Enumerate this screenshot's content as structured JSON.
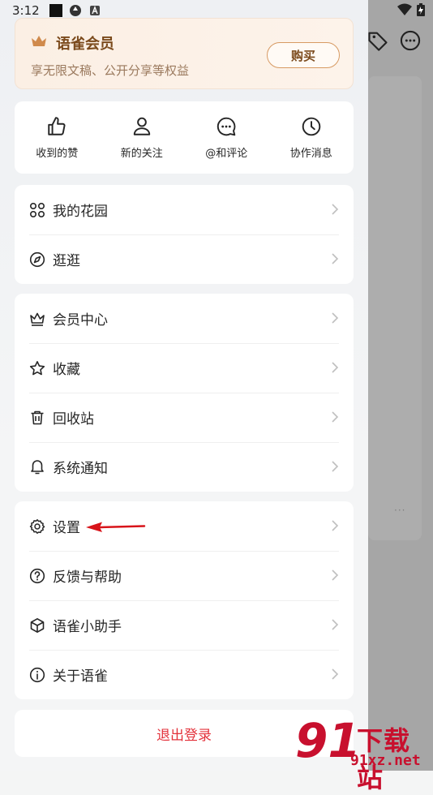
{
  "status_bar": {
    "time": "3:12"
  },
  "vip": {
    "title": "语雀会员",
    "subtitle": "享无限文稿、公开分享等权益",
    "buy_label": "购买"
  },
  "quick_actions": [
    {
      "label": "收到的赞",
      "icon": "thumbs-up-icon"
    },
    {
      "label": "新的关注",
      "icon": "person-icon"
    },
    {
      "label": "@和评论",
      "icon": "comment-icon"
    },
    {
      "label": "协作消息",
      "icon": "clock-icon"
    }
  ],
  "menu_group_1": [
    {
      "label": "我的花园",
      "icon": "garden-icon"
    },
    {
      "label": "逛逛",
      "icon": "compass-icon"
    }
  ],
  "menu_group_2": [
    {
      "label": "会员中心",
      "icon": "crown-icon"
    },
    {
      "label": "收藏",
      "icon": "star-icon"
    },
    {
      "label": "回收站",
      "icon": "trash-icon"
    },
    {
      "label": "系统通知",
      "icon": "bell-icon"
    }
  ],
  "menu_group_3": [
    {
      "label": "设置",
      "icon": "gear-icon"
    },
    {
      "label": "反馈与帮助",
      "icon": "help-icon"
    },
    {
      "label": "语雀小助手",
      "icon": "cube-icon"
    },
    {
      "label": "关于语雀",
      "icon": "info-icon"
    }
  ],
  "logout_label": "退出登录",
  "watermark": {
    "text": "下载站",
    "url": "91xz.net",
    "logo": "91"
  },
  "background": {
    "more_dots": "···"
  },
  "colors": {
    "accent_red": "#e3323b",
    "vip_brown": "#7b4a1c",
    "annotation_red": "#d8141a"
  }
}
